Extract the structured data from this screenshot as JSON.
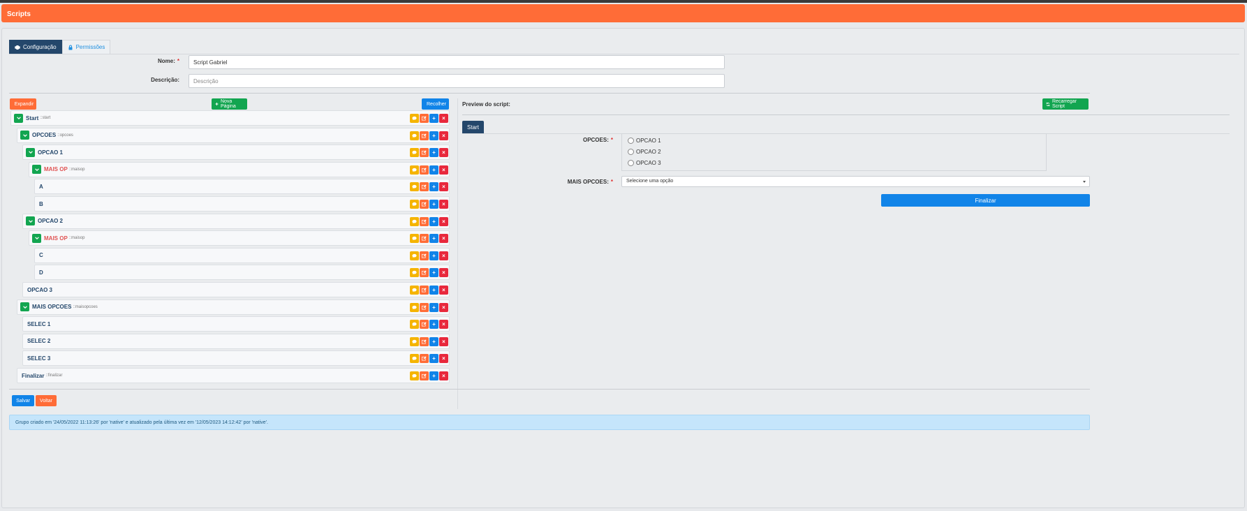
{
  "header": {
    "title": "Scripts"
  },
  "tabs": [
    {
      "label": "Configuração",
      "icon": "gear-icon"
    },
    {
      "label": "Permissões",
      "icon": "lock-icon"
    }
  ],
  "form": {
    "name_label": "Nome:",
    "name_required": "*",
    "name_value": "Script Gabriel",
    "description_label": "Descrição:",
    "description_placeholder": "Descrição"
  },
  "toolbar": {
    "expand_label": "Expandir",
    "new_page_label": "Nova Página",
    "collapse_label": "Recolher"
  },
  "tree": [
    {
      "name": "Start",
      "key": "::start",
      "level": 0,
      "expandable": true,
      "highlight": false
    },
    {
      "name": "OPCOES",
      "key": "::opcoes",
      "level": 1,
      "expandable": true,
      "highlight": false
    },
    {
      "name": "OPCAO 1",
      "key": "",
      "level": 2,
      "expandable": true,
      "highlight": false
    },
    {
      "name": "MAIS OP",
      "key": "::maisop",
      "level": 3,
      "expandable": true,
      "highlight": true
    },
    {
      "name": "A",
      "key": "",
      "level": 4,
      "expandable": false,
      "highlight": false
    },
    {
      "name": "B",
      "key": "",
      "level": 4,
      "expandable": false,
      "highlight": false
    },
    {
      "name": "OPCAO 2",
      "key": "",
      "level": 2,
      "expandable": true,
      "highlight": false
    },
    {
      "name": "MAIS OP",
      "key": "::maisop",
      "level": 3,
      "expandable": true,
      "highlight": true
    },
    {
      "name": "C",
      "key": "",
      "level": 4,
      "expandable": false,
      "highlight": false
    },
    {
      "name": "D",
      "key": "",
      "level": 4,
      "expandable": false,
      "highlight": false
    },
    {
      "name": "OPCAO 3",
      "key": "",
      "level": 2,
      "expandable": false,
      "highlight": false
    },
    {
      "name": "MAIS OPCOES",
      "key": "::maisopcoes",
      "level": 1,
      "expandable": true,
      "highlight": false
    },
    {
      "name": "SELEC 1",
      "key": "",
      "level": 2,
      "expandable": false,
      "highlight": false
    },
    {
      "name": "SELEC 2",
      "key": "",
      "level": 2,
      "expandable": false,
      "highlight": false
    },
    {
      "name": "SELEC 3",
      "key": "",
      "level": 2,
      "expandable": false,
      "highlight": false
    },
    {
      "name": "Finalizar",
      "key": "::finalizar",
      "level": 1,
      "expandable": false,
      "highlight": false
    }
  ],
  "row_actions": [
    "comment-icon",
    "edit-icon",
    "plus-icon",
    "close-icon"
  ],
  "preview": {
    "title": "Preview do script:",
    "reload_label": "Recarregar Script",
    "tab_label": "Start",
    "opcoes_label": "OPCOES:",
    "opcoes_required": "*",
    "options": [
      "OPCAO 1",
      "OPCAO 2",
      "OPCAO 3"
    ],
    "mais_opcoes_label": "MAIS OPCOES:",
    "mais_opcoes_required": "*",
    "select_value": "Selecione uma opção",
    "finish_label": "Finalizar"
  },
  "footer": {
    "save_label": "Salvar",
    "back_label": "Voltar",
    "info_text": "Grupo criado em '24/05/2022 11:13:26' por 'native' e atualizado pela última vez em '12/05/2023 14:12:42' por 'native'."
  },
  "colors": {
    "brand": "#ff6c37",
    "navy": "#24476b",
    "green": "#12a550",
    "blue": "#1184e8",
    "yellow": "#f5b400",
    "red": "#e8283c"
  }
}
